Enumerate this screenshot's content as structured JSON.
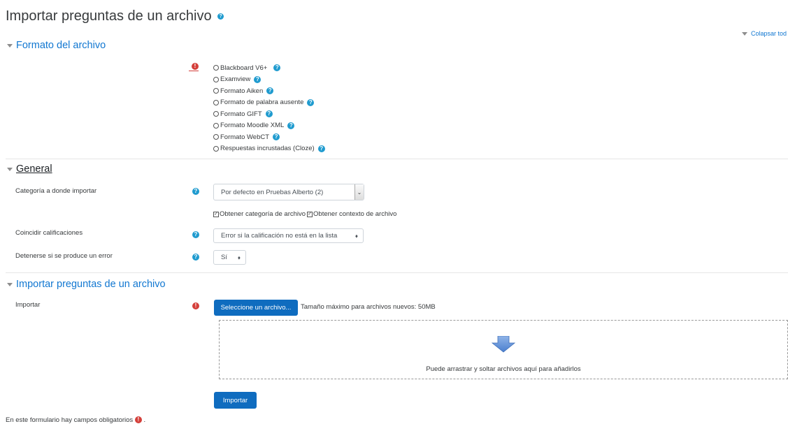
{
  "page": {
    "title": "Importar preguntas de un archivo",
    "collapse_all": "Colapsar tod"
  },
  "sections": {
    "format": {
      "title": "Formato del archivo"
    },
    "general": {
      "title": "General"
    },
    "import": {
      "title": "Importar preguntas de un archivo"
    }
  },
  "format_options": [
    {
      "label": "Blackboard V6+",
      "selected": false
    },
    {
      "label": "Examview",
      "selected": false
    },
    {
      "label": "Formato Aiken",
      "selected": false
    },
    {
      "label": "Formato de palabra ausente",
      "selected": false
    },
    {
      "label": "Formato GIFT",
      "selected": false
    },
    {
      "label": "Formato Moodle XML",
      "selected": false
    },
    {
      "label": "Formato WebCT",
      "selected": false
    },
    {
      "label": "Respuestas incrustadas (Cloze)",
      "selected": false
    }
  ],
  "general": {
    "category_label": "Categoría a donde importar",
    "category_value": "Por defecto en Pruebas Alberto (2)",
    "checkbox_category": {
      "label": "Obtener categoría de archivo",
      "checked": true
    },
    "checkbox_context": {
      "label": "Obtener contexto de archivo",
      "checked": true
    },
    "grades_label": "Coincidir calificaciones",
    "grades_value": "Error si la calificación no está en la lista",
    "stop_label": "Detenerse si se produce un error",
    "stop_value": "Sí"
  },
  "import": {
    "label": "Importar",
    "choose_button": "Seleccione un archivo...",
    "max_size": "Tamaño máximo para archivos nuevos: 50MB",
    "dropzone_text": "Puede arrastrar y soltar archivos aquí para añadirlos",
    "submit": "Importar"
  },
  "footer": {
    "required_note": "En este formulario hay campos obligatorios",
    "trailing": "."
  },
  "colors": {
    "link": "#1177d1",
    "primary_button": "#0f6cbf",
    "help_icon": "#1f9bcf",
    "required_icon": "#d43f3a",
    "dropzone_arrow": "#5b8fd6"
  }
}
